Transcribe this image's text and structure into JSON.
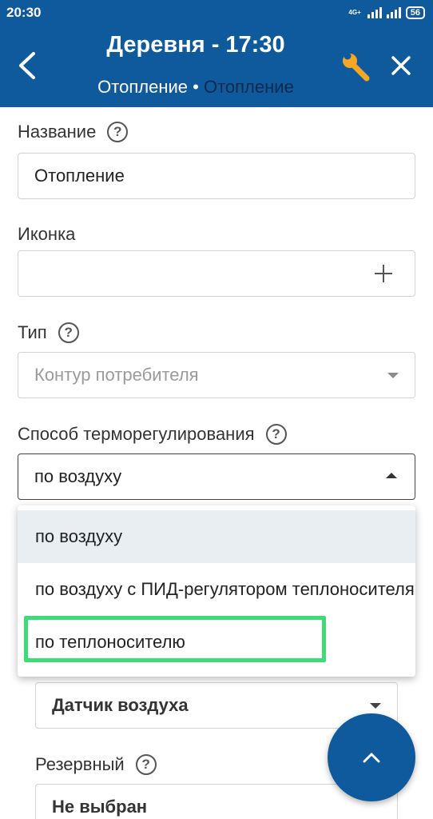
{
  "status_bar": {
    "time": "20:30",
    "network_label": "4G+",
    "battery": "56"
  },
  "header": {
    "title": "Деревня  - 17:30",
    "breadcrumb_parent": "Отопление",
    "separator": "•",
    "breadcrumb_current": "Отопление",
    "accent_color": "#0f5a9c",
    "wrench_color": "#f5a623",
    "icons": [
      "chevron-left-icon",
      "wrench-icon",
      "close-icon"
    ]
  },
  "form": {
    "name": {
      "label": "Название",
      "value": "Отопление"
    },
    "icon": {
      "label": "Иконка",
      "value": ""
    },
    "type": {
      "label": "Тип",
      "value": "Контур потребителя"
    },
    "regulation": {
      "label": "Способ терморегулирования",
      "value": "по воздуху"
    },
    "sensor": {
      "value": "Датчик воздуха"
    },
    "reserve": {
      "label": "Резервный",
      "value": "Не выбран"
    }
  },
  "dropdown": {
    "options": [
      "по воздуху",
      "по воздуху с ПИД-регулятором теплоносителя",
      "по теплоносителю"
    ],
    "selected_index": 0,
    "highlight_color": "#3ddc76"
  },
  "fab": {
    "icon": "chevron-up-icon"
  }
}
